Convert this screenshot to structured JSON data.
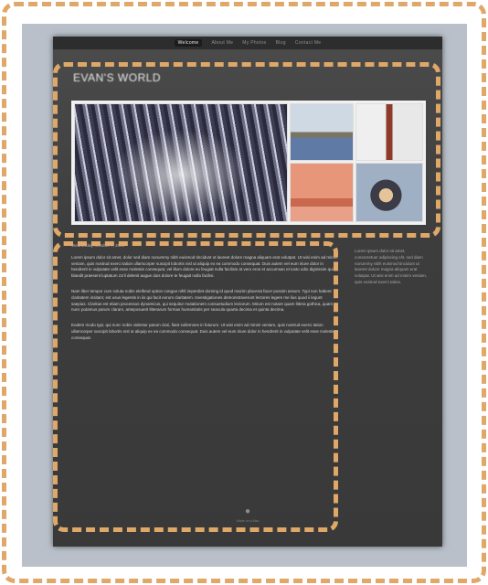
{
  "nav": {
    "items": [
      "Welcome",
      "About Me",
      "My Photos",
      "Blog",
      "Contact Me"
    ],
    "active_index": 0
  },
  "site": {
    "title": "EVAN'S WORLD"
  },
  "gallery": {
    "photos": [
      "forest-photo",
      "lake-landscape-photo",
      "house-facade-photo",
      "sunset-photo",
      "portrait-photo"
    ]
  },
  "article": {
    "date": "Wednesday, October 7, 2009",
    "paragraphs": [
      "Lorem ipsum dolor sit amet, dolor sed diam nonummy nibh euismod tincidunt ut laoreet dolore magna aliquam erat volutpat. Ut wisi enim ad minim veniam, quis nostrud exerci tation ullamcorper suscipit lobortis nisl ut aliquip ex ea commodo consequat. Duis autem vel eum iriure dolor in hendrerit in vulputate velit esse molestie consequat, vel illum dolore eu feugiat nulla facilisis at vero eros et accumsan et iusto odio dignissim qui blandit praesent luptatum zzril delenit augue duis dolore te feugait nulla facilisi.",
      "Nam liber tempor cum soluta nobis eleifend option congue nihil imperdiet doming id quod mazim placerat facer possim assum. Typi non habent claritatem insitam; est usus legentis in iis qui facit eorum claritatem. Investigationes demonstraverunt lectores legere me lius quod ii legunt saepius. Claritas est etiam processus dynamicus, qui sequitur mutationem consuetudium lectorum. Mirum est notare quam littera gothica, quam nunc putamus parum claram, anteposuerit litterarum formas humanitatis per seacula quarta decima et quinta decima.",
      "Eodem modo typi, qui nunc nobis videntur parum clari, fiant sollemnes in futurum. Ut wisi enim ad minim veniam, quis nostrud exerci tation ullamcorper suscipit lobortis nisl ut aliquip ex ea commodo consequat. Duis autem vel eum iriure dolor in hendrerit in vulputate velit esse molestie consequat."
    ]
  },
  "sidebar": {
    "text": "Lorem ipsum dolor sit amet, consectetuer adipiscing elit, sed diam nonummy nibh euismod tincidunt ut laoreet dolore magna aliquam erat volutpat. Ut wisi enim ad minim veniam, quis nostrud exerci tation."
  },
  "footer": {
    "icon": "apple-logo-icon",
    "text": "Made on a Mac"
  },
  "colors": {
    "backdrop": "#b9c0c9",
    "page": "#3f3f3f",
    "annotation": "#e0a868"
  }
}
